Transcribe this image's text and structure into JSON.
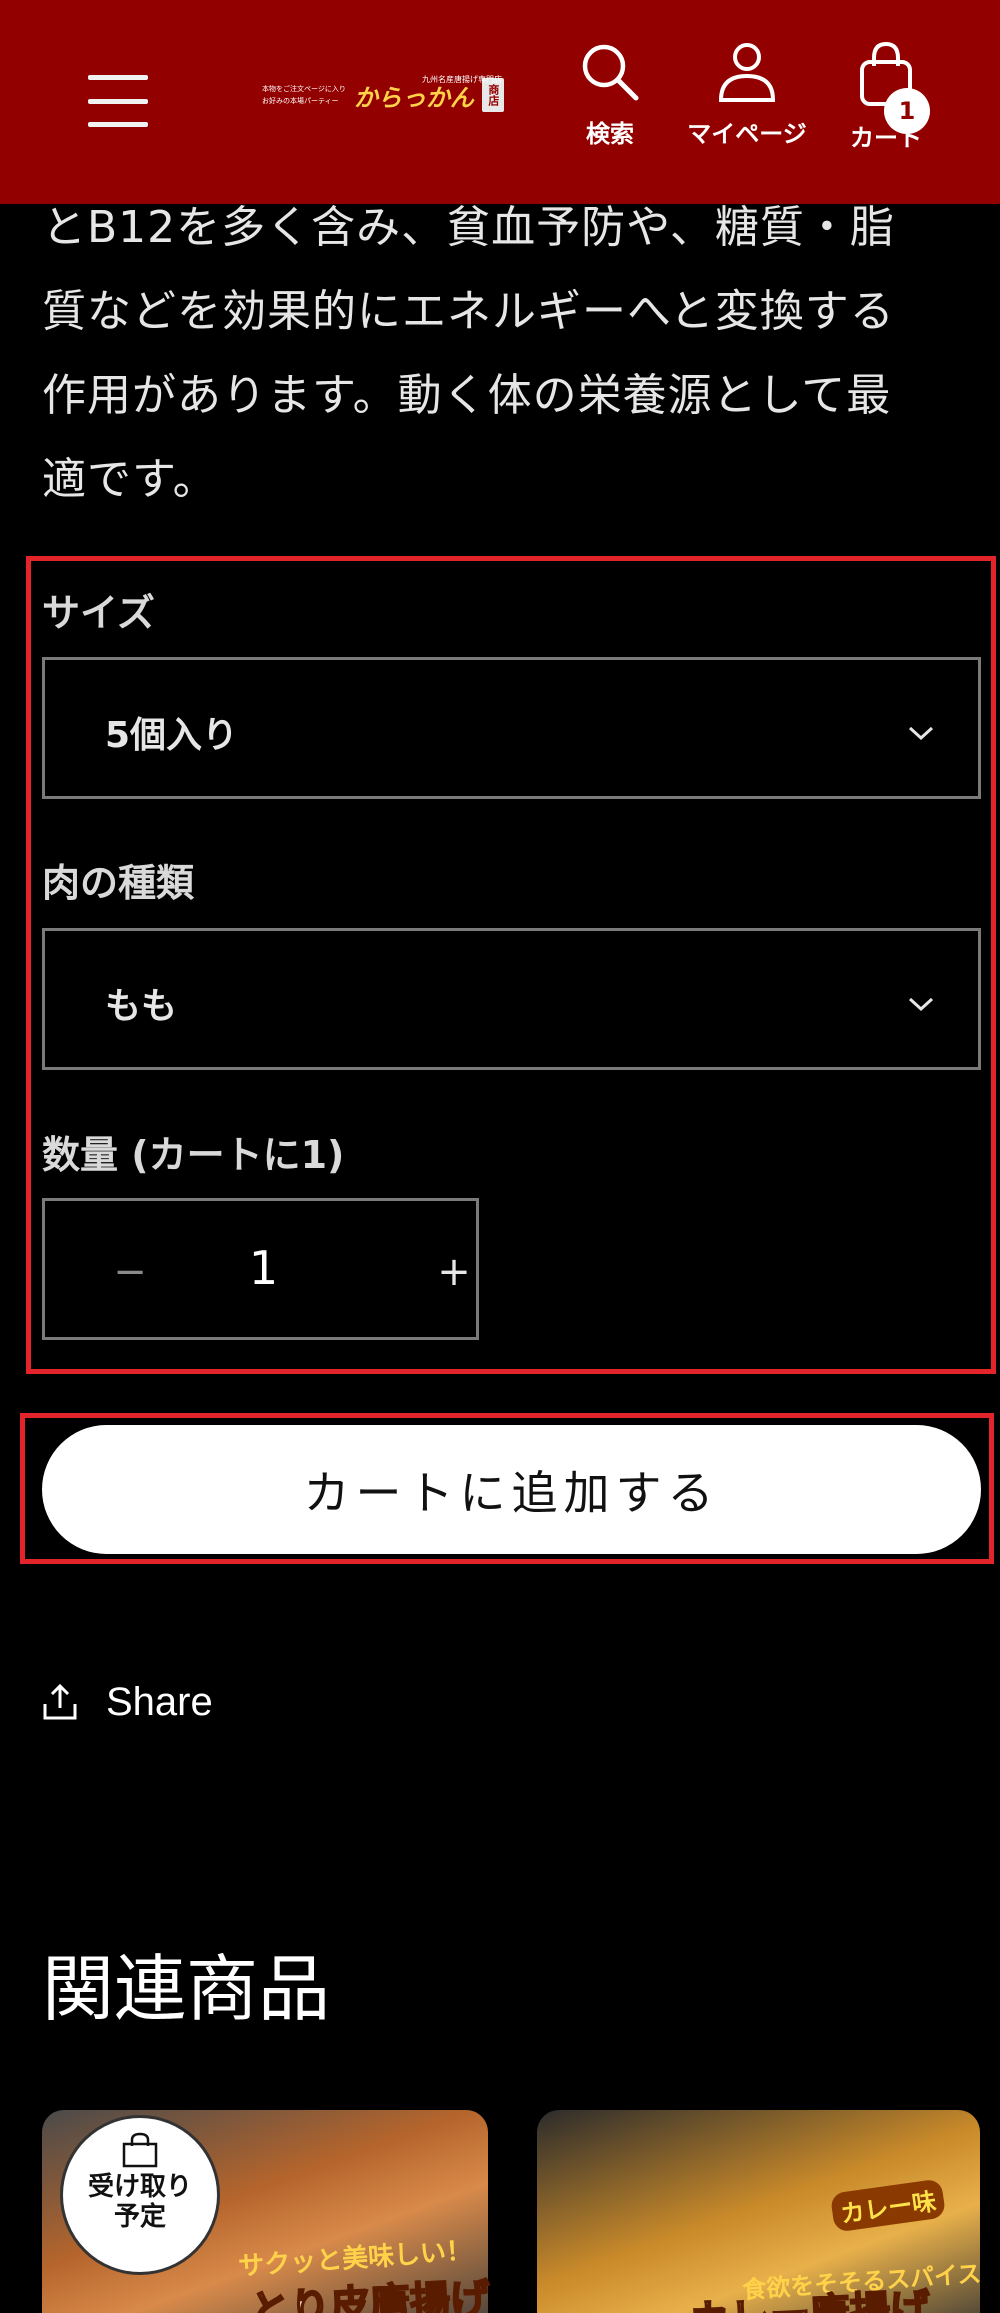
{
  "header": {
    "logo": {
      "tagline_1": "本物をご注文ページに入り",
      "tagline_2": "お好みの本場パーティー",
      "small_caption": "九州名産唐揚げ専門店",
      "brand_name": "からっかん",
      "seal": "商店"
    },
    "search_label": "検索",
    "account_label": "マイページ",
    "cart_label": "カート",
    "cart_count": "1"
  },
  "description": {
    "lines": [
      "とB12を多く含み、貧血予防や、糖質・脂",
      "質などを効果的にエネルギーへと変換する",
      "作用があります。動く体の栄養源として最",
      "適です。"
    ]
  },
  "options": {
    "size_label": "サイズ",
    "size_value": "5個入り",
    "meat_label": "肉の種類",
    "meat_value": "もも",
    "quantity_label": "数量 (カートに1)",
    "quantity_value": "1",
    "minus_symbol": "−",
    "plus_symbol": "+"
  },
  "add_to_cart_label": "カートに追加する",
  "share_label": "Share",
  "related": {
    "title": "関連商品",
    "pickup_badge_line1": "受け取り",
    "pickup_badge_line2": "予定",
    "card1_caption": "サクッと美味しい！",
    "card1_title": "とり皮唐揚げ",
    "card2_tag": "カレー味",
    "card2_caption": "食欲をそそるスパイス",
    "card2_title": "カレー唐揚げ"
  },
  "colors": {
    "header_bg": "#930000",
    "highlight_border": "#e3242b",
    "button_bg": "#ffffff"
  },
  "icons": [
    "menu-icon",
    "search-icon",
    "account-icon",
    "cart-icon",
    "chevron-down-icon",
    "share-icon",
    "bag-icon"
  ]
}
